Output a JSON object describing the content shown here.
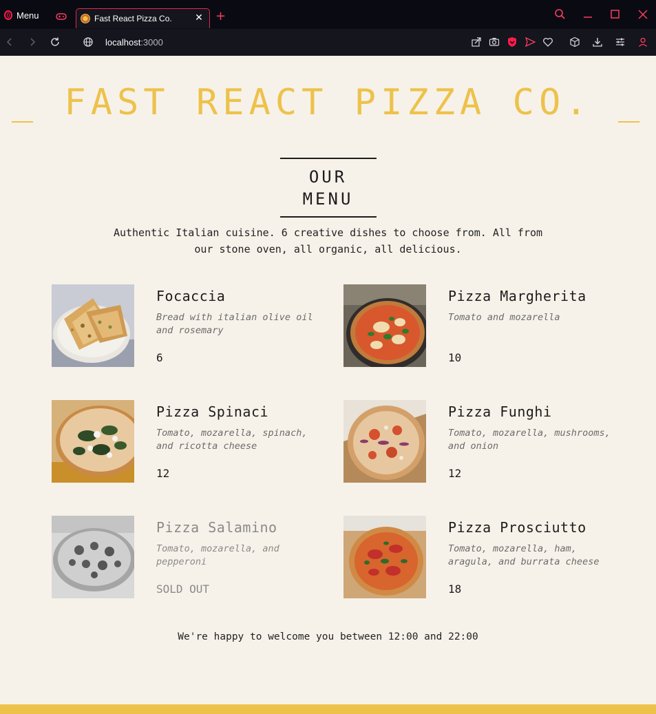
{
  "browser": {
    "menu_label": "Menu",
    "tab_title": "Fast React Pizza Co.",
    "new_tab_symbol": "+",
    "close_symbol": "✕",
    "url_host": "localhost",
    "url_port": ":3000",
    "accent_color": "#ff1b4c"
  },
  "page": {
    "brand_title": "_ FAST REACT PIZZA CO. _",
    "menu_heading": "OUR MENU",
    "intro": "Authentic Italian cuisine. 6 creative dishes to choose from. All from our stone oven, all organic, all delicious.",
    "hours_text": "We're happy to welcome you between 12:00 and 22:00",
    "brand_color": "#edc24b",
    "background_color": "#f7f2e9"
  },
  "menu": {
    "items": [
      {
        "name": "Focaccia",
        "ingredients": "Bread with italian olive oil and rosemary",
        "price": "6",
        "sold_out": false
      },
      {
        "name": "Pizza Margherita",
        "ingredients": "Tomato and mozarella",
        "price": "10",
        "sold_out": false
      },
      {
        "name": "Pizza Spinaci",
        "ingredients": "Tomato, mozarella, spinach, and ricotta cheese",
        "price": "12",
        "sold_out": false
      },
      {
        "name": "Pizza Funghi",
        "ingredients": "Tomato, mozarella, mushrooms, and onion",
        "price": "12",
        "sold_out": false
      },
      {
        "name": "Pizza Salamino",
        "ingredients": "Tomato, mozarella, and pepperoni",
        "price": "SOLD OUT",
        "sold_out": true
      },
      {
        "name": "Pizza Prosciutto",
        "ingredients": "Tomato, mozarella, ham, aragula, and burrata cheese",
        "price": "18",
        "sold_out": false
      }
    ]
  }
}
